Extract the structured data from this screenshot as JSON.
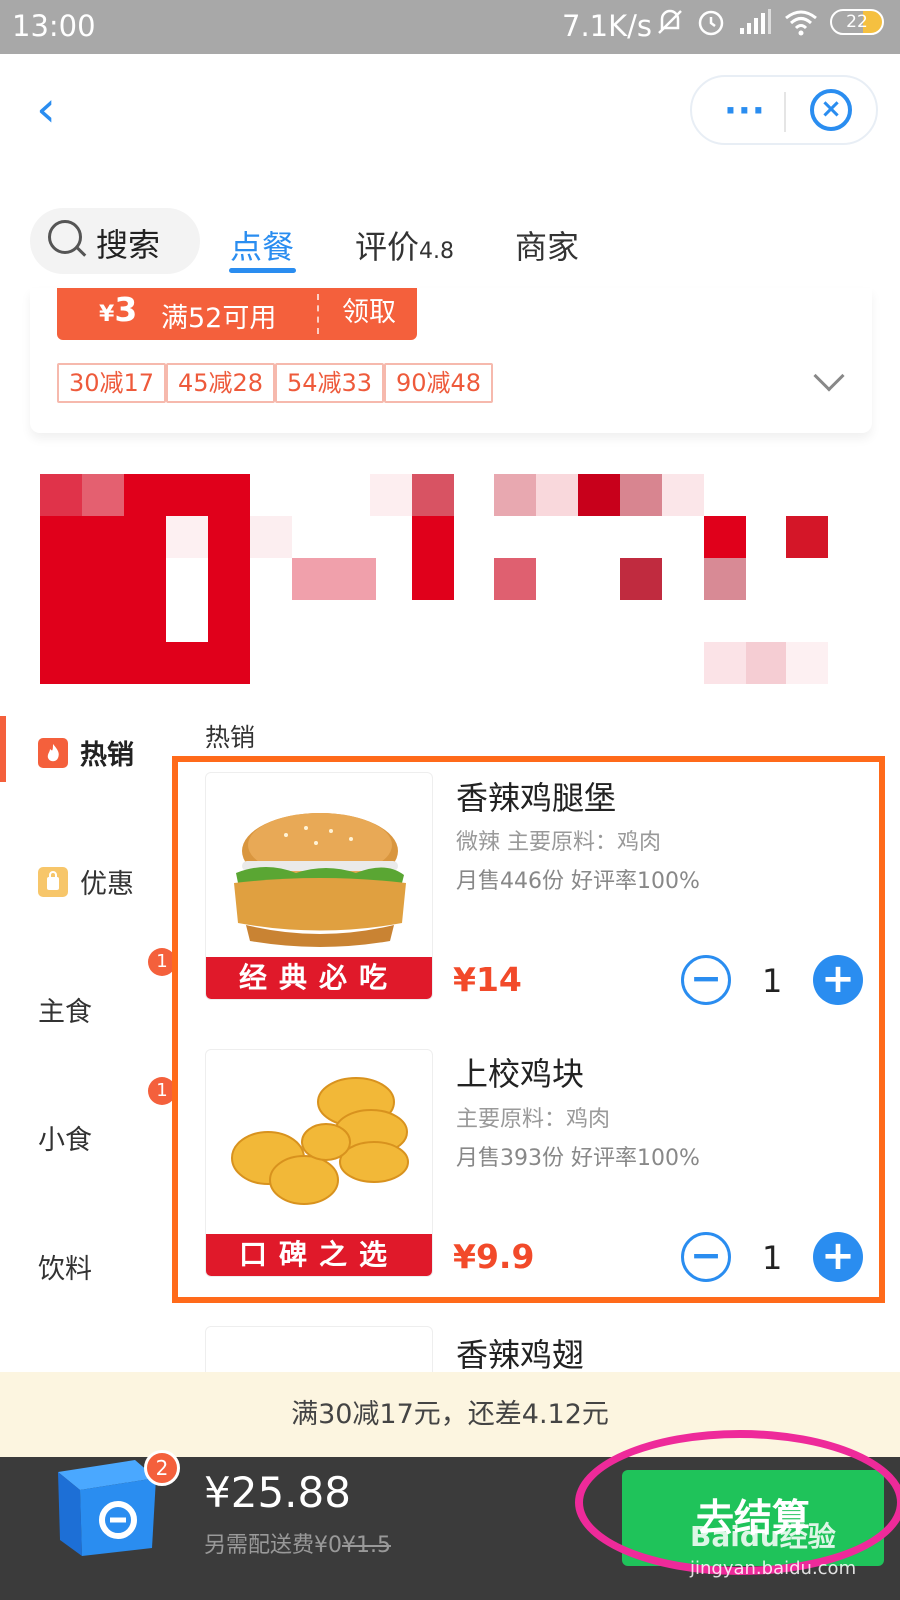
{
  "status_bar": {
    "time": "13:00",
    "speed": "7.1K/s",
    "battery": "22"
  },
  "header": {
    "back_icon": "chevron-left-icon",
    "more_icon": "more-icon",
    "close_icon": "close-mini-program-icon",
    "more_glyph": "···",
    "close_glyph": "×",
    "back_glyph": "‹"
  },
  "tabs": {
    "search": "搜索",
    "order": "点餐",
    "review": "评价",
    "review_score": "4.8",
    "merchant": "商家"
  },
  "promo": {
    "coupon_currency": "¥",
    "coupon_amount": "3",
    "coupon_condition": "满52可用",
    "coupon_action": "领取",
    "tags": [
      "30减17",
      "45减28",
      "54减33",
      "90减48"
    ]
  },
  "brand_color": "#e0001b",
  "sidebar": {
    "items": [
      {
        "label": "热销",
        "icon": "flame-icon"
      },
      {
        "label": "优惠",
        "icon": "discount-bag-icon"
      },
      {
        "label": "主食",
        "badge": "1"
      },
      {
        "label": "小食",
        "badge": "1"
      },
      {
        "label": "饮料"
      }
    ]
  },
  "menu": {
    "section": "热销",
    "items": [
      {
        "name": "香辣鸡腿堡",
        "desc": "微辣 主要原料：鸡肉",
        "sales": "月售446份 好评率100%",
        "price": "¥14",
        "qty": "1",
        "label": "经典必吃"
      },
      {
        "name": "上校鸡块",
        "desc": "主要原料：鸡肉",
        "sales": "月售393份 好评率100%",
        "price": "¥9.9",
        "qty": "1",
        "label": "口碑之选"
      },
      {
        "name": "香辣鸡翅"
      }
    ],
    "minus_glyph": "−",
    "plus_glyph": "+"
  },
  "discount_hint": "满30减17元，还差4.12元",
  "cart": {
    "badge": "2",
    "total": "¥25.88",
    "fee_prefix": "另需配送费¥0",
    "fee_original": "¥1.5",
    "checkout": "去结算"
  },
  "watermark": {
    "brand": "Baidu经验",
    "url": "jingyan.baidu.com"
  },
  "colors": {
    "accent": "#2a8df0",
    "promo": "#f4603c",
    "checkout": "#1fc35a",
    "highlight_box": "#ff6a1a",
    "highlight_ellipse": "#ee2a9a"
  }
}
